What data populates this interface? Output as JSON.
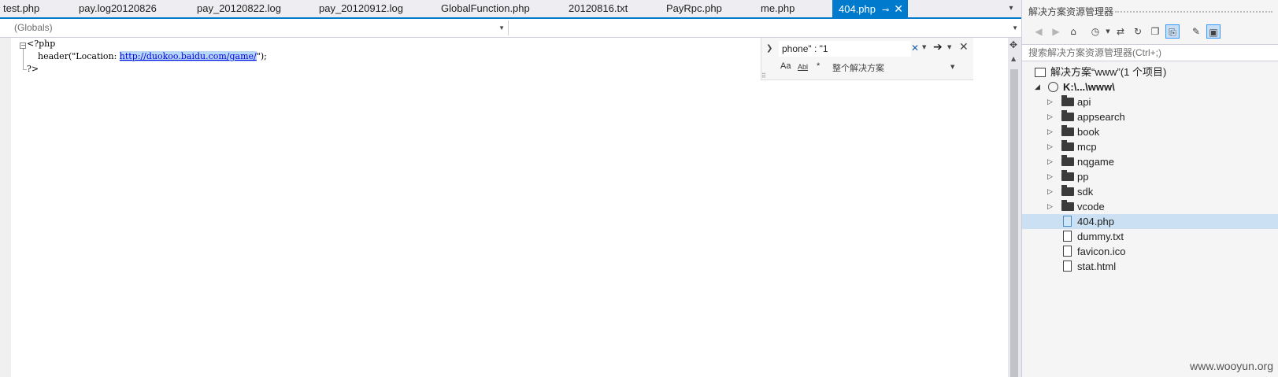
{
  "editor": {
    "tabs": [
      {
        "label": "test.php"
      },
      {
        "label": "pay.log20120826"
      },
      {
        "label": "pay_20120822.log"
      },
      {
        "label": "pay_20120912.log"
      },
      {
        "label": "GlobalFunction.php"
      },
      {
        "label": "20120816.txt"
      },
      {
        "label": "PayRpc.php"
      },
      {
        "label": "me.php"
      }
    ],
    "active_tab": {
      "label": "404.php",
      "pin_icon": "pin-icon",
      "close_icon": "close-icon"
    },
    "navigation": {
      "scope": "(Globals)",
      "member": ""
    },
    "code": {
      "line1": "<?php",
      "line2_prefix": "    header(\"Location: ",
      "line2_url": "http://duokoo.baidu.com/game/",
      "line2_suffix": "\");",
      "line3": "?>"
    },
    "find": {
      "query": "phone\" : \"1",
      "option_match_case": "Aa",
      "option_whole_word": "Abl",
      "option_regex": "*",
      "scope": "整个解决方案"
    }
  },
  "solution_explorer": {
    "title": "解决方案资源管理器",
    "search_placeholder": "搜索解决方案资源管理器(Ctrl+;)",
    "solution_label": "解决方案“www”(1 个项目)",
    "project_label": "K:\\...\\www\\",
    "folders": [
      "api",
      "appsearch",
      "book",
      "mcp",
      "nqgame",
      "pp",
      "sdk",
      "vcode"
    ],
    "files": [
      {
        "name": "404.php",
        "icon": "php-file-icon",
        "selected": true
      },
      {
        "name": "dummy.txt",
        "icon": "text-file-icon",
        "selected": false
      },
      {
        "name": "favicon.ico",
        "icon": "image-file-icon",
        "selected": false
      },
      {
        "name": "stat.html",
        "icon": "html-file-icon",
        "selected": false
      }
    ]
  },
  "watermark": "www.wooyun.org",
  "colors": {
    "accent": "#007acc",
    "selection": "#cce0f4",
    "url": "#0000e6"
  }
}
